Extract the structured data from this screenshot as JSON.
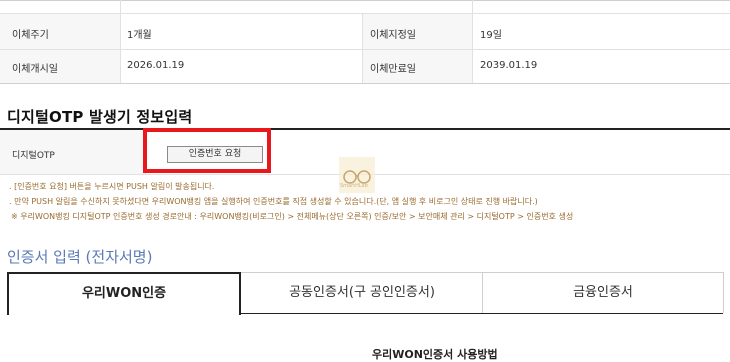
{
  "transfer_table": {
    "rows": [
      {
        "label1": "이체주기",
        "value1": "1개월",
        "label2": "이체지정일",
        "value2": "19일"
      },
      {
        "label1": "이체개시일",
        "value1": "2026.01.19",
        "label2": "이체만료일",
        "value2": "2039.01.19"
      }
    ]
  },
  "otp_section": {
    "title": "디지털OTP 발생기 정보입력",
    "row_label": "디지털OTP",
    "request_button": "인증번호 요청",
    "notes": [
      ". [인증번호 요청] 버튼을 누르시면 PUSH 알림이 발송됩니다.",
      ". 만약 PUSH 알림을 수신하지 못하셨다면 우리WON뱅킹 앱을 실행하여 인증번호를 직접 생성할 수 있습니다.(단, 앱 실행 후 비로그인 상태로 진행 바랍니다.)",
      "※ 우리WON뱅킹 디지털OTP 인증번호 생성 경로안내 : 우리WON뱅킹(비로그인) > 전체메뉴(상단 오른쪽) 인증/보안 > 보안매체 관리 > 디지털OTP > 인증번호 생성"
    ]
  },
  "cert_section": {
    "title": "인증서 입력 (전자서명)",
    "tabs": [
      {
        "label": "우리WON인증",
        "active": true
      },
      {
        "label": "공동인증서(구 공인인증서)",
        "active": false
      },
      {
        "label": "금융인증서",
        "active": false
      }
    ],
    "bottom_text": "우리WON인증서 사용방법"
  },
  "watermark": {
    "text": "SmartHLab"
  },
  "colors": {
    "highlight_red": "#e8191c",
    "note_brown": "#9a6a2e",
    "cert_title_blue": "#5a7ab8",
    "label_bg": "#f7f7f7"
  }
}
